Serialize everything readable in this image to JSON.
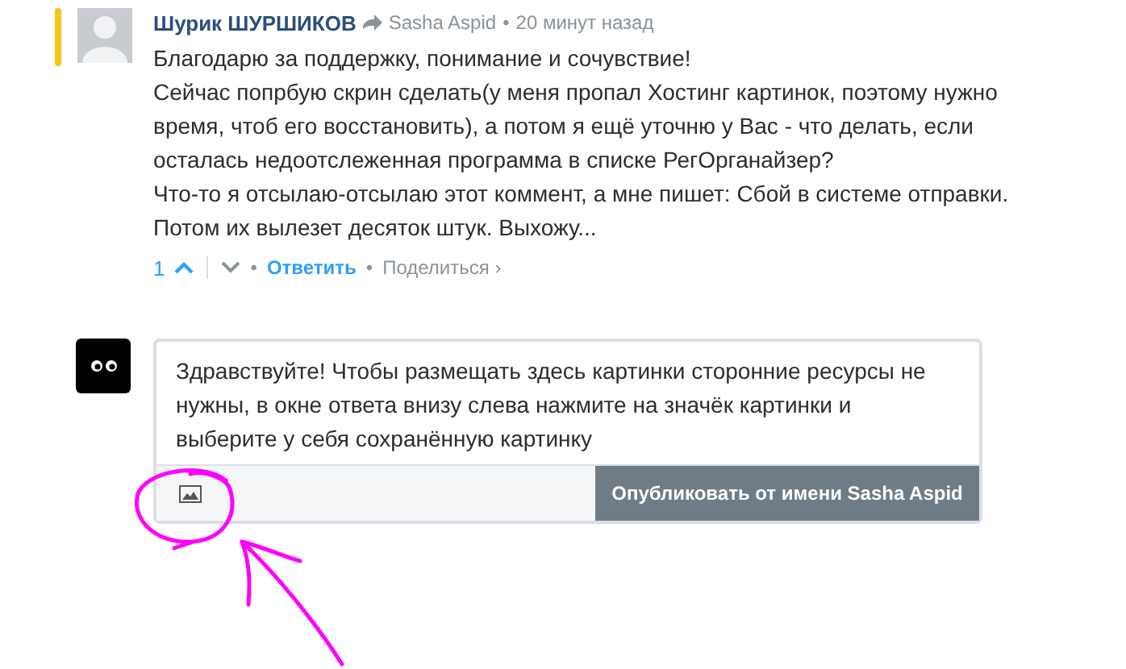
{
  "comment": {
    "author": "Шурик ШУРШИКОВ",
    "reply_to": "Sasha Aspid",
    "separator": "•",
    "time": "20 минут назад",
    "highlighted": true,
    "paragraphs": [
      "Благодарю за поддержку, понимание и сочувствие!",
      "Сейчас попрбую скрин сделать(у меня пропал Хостинг картинок, поэтому нужно время, чтоб его восстановить), а потом я ещё уточню у Вас - что делать, если осталась недоотслеженная программа в списке РегОрганайзер?",
      "Что-то я отсылаю-отсылаю этот коммент, а мне пишет: Сбой в системе отправки. Потом их вылезет десяток штук. Выхожу..."
    ],
    "votes": "1",
    "upvoted": true,
    "reply_label": "Ответить",
    "share_label": "Поделиться ›",
    "dot": "•"
  },
  "reply_form": {
    "value": "Здравствуйте! Чтобы размещать здесь картинки сторонние ресурсы не нужны, в окне ответа внизу слева нажмите на значёк картинки и выберите у себя сохранённую картинку",
    "submit_label": "Опубликовать от имени Sasha Aspid"
  }
}
